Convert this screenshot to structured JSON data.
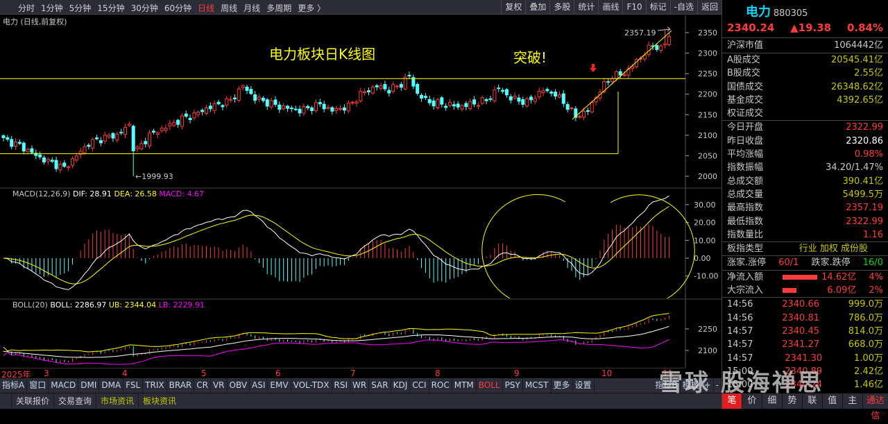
{
  "toolbar": {
    "timeframes": [
      "分时",
      "1分钟",
      "5分钟",
      "15分钟",
      "30分钟",
      "60分钟",
      "日线",
      "周线",
      "月线",
      "多周期",
      "更多 〉"
    ],
    "active": "日线",
    "tools": [
      "复权",
      "叠加",
      "多股",
      "统计",
      "画线",
      "F10",
      "标记",
      "-自选",
      "返回"
    ]
  },
  "chart_title": "电力 (日线,前复权)",
  "annotations": {
    "title": "电力板块日K线图",
    "breakout": "突破!",
    "low_label": "←1999.93",
    "high_label": "2357.19"
  },
  "macd_header": {
    "name": "MACD(12,26,9)",
    "dif": "DIF: 28.91",
    "dea": "DEA: 26.58",
    "macd": "MACD: 4.67"
  },
  "boll_header": {
    "name": "BOLL(20)",
    "boll": "BOLL: 2286.97",
    "ub": "UB: 2344.04",
    "lb": "LB: 2229.91"
  },
  "colors": {
    "up": "#ff3b3b",
    "down": "#54ffff",
    "dif": "#ffffff",
    "dea": "#ffff00",
    "lb": "#ff00ff",
    "annot": "#ffff00"
  },
  "chart_data": [
    {
      "type": "candlestick",
      "name": "price",
      "ylim": [
        1975,
        2375
      ],
      "y_ticks": [
        "2350",
        "2300",
        "2250",
        "2200",
        "2150",
        "2100",
        "2050",
        "2000"
      ],
      "x_ticks": [
        "2025年",
        "3",
        "4",
        "5",
        "6",
        "7",
        "8",
        "9",
        "10",
        "11"
      ],
      "close_path": [
        [
          0,
          2090
        ],
        [
          4,
          2075
        ],
        [
          9,
          2045
        ],
        [
          15,
          2020
        ],
        [
          18,
          2050
        ],
        [
          21,
          2080
        ],
        [
          25,
          2095
        ],
        [
          28,
          2100
        ],
        [
          31,
          2125
        ],
        [
          32,
          2070
        ],
        [
          33,
          2065
        ],
        [
          36,
          2100
        ],
        [
          40,
          2120
        ],
        [
          44,
          2140
        ],
        [
          47,
          2150
        ],
        [
          50,
          2165
        ],
        [
          56,
          2185
        ],
        [
          59,
          2220
        ],
        [
          62,
          2190
        ],
        [
          68,
          2170
        ],
        [
          73,
          2160
        ],
        [
          78,
          2175
        ],
        [
          81,
          2160
        ],
        [
          85,
          2170
        ],
        [
          88,
          2200
        ],
        [
          92,
          2220
        ],
        [
          95,
          2210
        ],
        [
          98,
          2225
        ],
        [
          100,
          2245
        ],
        [
          102,
          2200
        ],
        [
          105,
          2180
        ],
        [
          109,
          2175
        ],
        [
          112,
          2170
        ],
        [
          115,
          2175
        ],
        [
          119,
          2185
        ],
        [
          122,
          2215
        ],
        [
          125,
          2190
        ],
        [
          129,
          2180
        ],
        [
          133,
          2210
        ],
        [
          136,
          2200
        ],
        [
          139,
          2170
        ],
        [
          141,
          2145
        ],
        [
          144,
          2160
        ],
        [
          147,
          2210
        ],
        [
          150,
          2245
        ],
        [
          153,
          2250
        ],
        [
          156,
          2280
        ],
        [
          160,
          2320
        ],
        [
          162,
          2310
        ],
        [
          164,
          2340
        ]
      ],
      "resistance": 2238,
      "support": 2055,
      "low": 1999.93,
      "high": 2357.19
    },
    {
      "type": "bar+line",
      "name": "MACD",
      "ylim": [
        -23,
        35
      ],
      "y_ticks": [
        "30.00",
        "20.00",
        "10.00",
        "0.00",
        "-10.00"
      ]
    },
    {
      "type": "line",
      "name": "BOLL",
      "ylim": [
        2020,
        2380
      ],
      "y_ticks": [
        "2250",
        "2100"
      ]
    }
  ],
  "indicator_tabs": [
    "指标A",
    "窗口",
    "MACD",
    "DMI",
    "DMA",
    "FSL",
    "TRIX",
    "BRAR",
    "CR",
    "VR",
    "OBV",
    "ASI",
    "EMV",
    "VOL-TDX",
    "RSI",
    "WR",
    "SAR",
    "KDJ",
    "CCI",
    "ROC",
    "MTM",
    "BOLL",
    "PSY",
    "MCST",
    "更多",
    "设置"
  ],
  "indicator_active": "BOLL",
  "indicator_right": [
    "指标B",
    "模板",
    "+",
    "-"
  ],
  "bottom_tabs": [
    "关联报价",
    "交易查询",
    "市场资讯",
    "板块资讯"
  ],
  "panel": {
    "name": "电力",
    "code": "880305",
    "price": "2340.24",
    "change": "▲19.38",
    "pct": "0.84%",
    "market_cap": {
      "label": "沪深市值",
      "value": "1064442亿"
    },
    "turnover": [
      {
        "label": "A股成交",
        "value": "20545.41亿"
      },
      {
        "label": "B股成交",
        "value": "2.55亿"
      },
      {
        "label": "国债成交",
        "value": "26348.62亿"
      },
      {
        "label": "基金成交",
        "value": "4392.65亿"
      },
      {
        "label": "权证成交",
        "value": ""
      }
    ],
    "stats": [
      {
        "label": "今日开盘",
        "value": "2322.99",
        "c": "red"
      },
      {
        "label": "昨日收盘",
        "value": "2320.86",
        "c": "wht"
      },
      {
        "label": "平均涨幅",
        "value": "0.98%",
        "c": "red"
      },
      {
        "label": "指数振幅",
        "value": "34.20/1.47%",
        "c": "gry"
      },
      {
        "label": "总成交额",
        "value": "390.41亿",
        "c": "yel"
      },
      {
        "label": "总成交量",
        "value": "5499.5万",
        "c": "yel"
      },
      {
        "label": "最高指数",
        "value": "2357.19",
        "c": "red"
      },
      {
        "label": "最低指数",
        "value": "2322.99",
        "c": "red"
      },
      {
        "label": "指数量比",
        "value": "1.16",
        "c": "red"
      }
    ],
    "type": {
      "label": "板指类型",
      "value": "行业 加权 成份股"
    },
    "updown": {
      "up_label": "涨家.涨停",
      "up": "60/1",
      "down_label": "跌家.跌停",
      "down": "16/0"
    },
    "flows": [
      {
        "label": "净流入额",
        "value": "14.62亿",
        "pct": "4%",
        "bar": 0.8
      },
      {
        "label": "大宗流入",
        "value": "6.09亿",
        "pct": "2%",
        "bar": 0.33
      }
    ],
    "ticks": [
      {
        "t": "14:56",
        "p": "2340.66",
        "v": "999.0万"
      },
      {
        "t": "14:56",
        "p": "2340.81",
        "v": "786.0万"
      },
      {
        "t": "14:57",
        "p": "2340.45",
        "v": "814.0万"
      },
      {
        "t": "14:57",
        "p": "2341.27",
        "v": "668.0万"
      },
      {
        "t": "14:57",
        "p": "2341.30",
        "v": "1.00万"
      },
      {
        "t": "15:00",
        "p": "2340.89",
        "v": "2.42亿"
      },
      {
        "t": "15:00",
        "p": "2340.24",
        "v": "1.46亿"
      }
    ],
    "tabs": [
      "笔",
      "价",
      "细",
      "势",
      "联",
      "值",
      "主"
    ],
    "tabs_extra": "通达信"
  },
  "watermark": "雪球  股海禅思"
}
